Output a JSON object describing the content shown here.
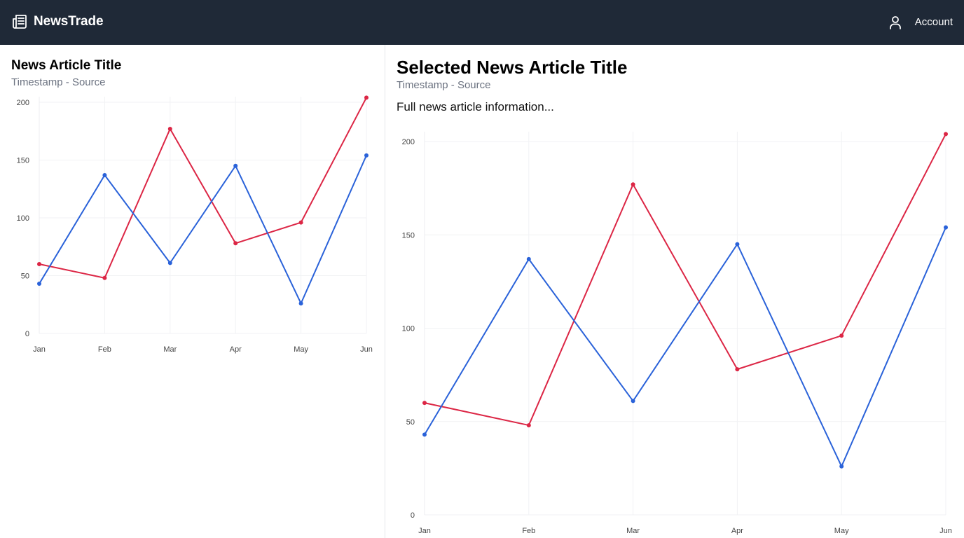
{
  "header": {
    "brand_name": "NewsTrade",
    "brand_icon": "newspaper-icon",
    "account_label": "Account",
    "account_icon": "user-icon",
    "background": "#1f2937"
  },
  "article_list": {
    "items": [
      {
        "title": "News Article Title",
        "meta": "Timestamp - Source"
      }
    ]
  },
  "detail": {
    "title": "Selected News Article Title",
    "meta": "Timestamp - Source",
    "body": "Full news article information..."
  },
  "chart_data": [
    {
      "type": "line",
      "categories": [
        "Jan",
        "Feb",
        "Mar",
        "Apr",
        "May",
        "Jun"
      ],
      "series": [
        {
          "color": "#dc2645",
          "values": [
            60,
            48,
            177,
            78,
            96,
            204
          ]
        },
        {
          "color": "#2a62d9",
          "values": [
            43,
            137,
            61,
            145,
            26,
            154
          ]
        }
      ],
      "yticks": [
        0,
        50,
        100,
        150,
        200
      ],
      "ylim": [
        0,
        200
      ],
      "grid": true,
      "legend": "none"
    },
    {
      "type": "line",
      "categories": [
        "Jan",
        "Feb",
        "Mar",
        "Apr",
        "May",
        "Jun"
      ],
      "series": [
        {
          "color": "#dc2645",
          "values": [
            60,
            48,
            177,
            78,
            96,
            204
          ]
        },
        {
          "color": "#2a62d9",
          "values": [
            43,
            137,
            61,
            145,
            26,
            154
          ]
        }
      ],
      "yticks": [
        0,
        50,
        100,
        150,
        200
      ],
      "ylim": [
        0,
        200
      ],
      "grid": true,
      "legend": "none"
    }
  ]
}
